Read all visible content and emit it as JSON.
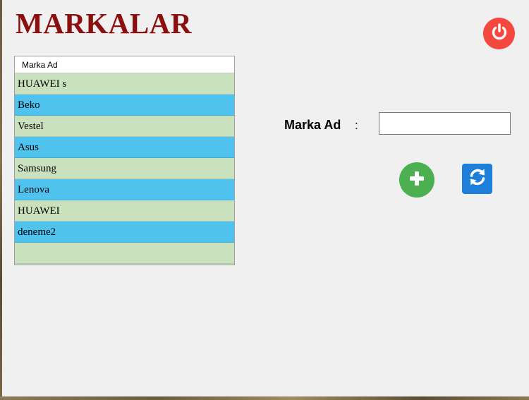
{
  "page": {
    "title": "MARKALAR"
  },
  "grid": {
    "column_header": "Marka Ad",
    "rows": [
      "HUAWEI s",
      "Beko",
      "Vestel",
      "Asus",
      "Samsung",
      "Lenova",
      "HUAWEI",
      "deneme2",
      ""
    ]
  },
  "form": {
    "label": "Marka Ad",
    "colon": ":",
    "input_value": "",
    "input_placeholder": ""
  },
  "icons": {
    "exit": "power-icon",
    "add": "plus-icon",
    "refresh": "refresh-icon"
  },
  "colors": {
    "title": "#8b0f0f",
    "row_green": "#c9e2bd",
    "row_blue": "#4fc3ee",
    "exit_button": "#f4473d",
    "add_button": "#4caf50",
    "refresh_button": "#1e7fd8"
  }
}
